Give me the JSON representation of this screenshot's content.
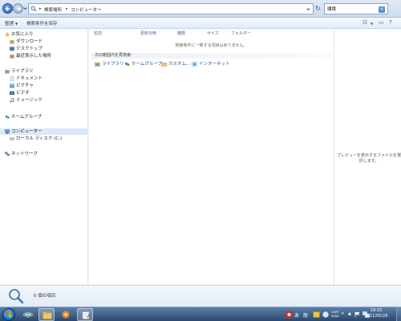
{
  "window": {
    "breadcrumb": [
      "検索場所",
      "コンピューター"
    ],
    "search_value": "環境"
  },
  "toolbar": {
    "organize_label": "整理",
    "save_search_label": "検索条件を保存"
  },
  "nav": {
    "favorites": {
      "label": "お気に入り",
      "items": [
        {
          "label": "ダウンロード",
          "icon": "download-folder-icon"
        },
        {
          "label": "デスクトップ",
          "icon": "desktop-icon"
        },
        {
          "label": "最近表示した場所",
          "icon": "recent-places-icon"
        }
      ]
    },
    "libraries": {
      "label": "ライブラリ",
      "items": [
        {
          "label": "ドキュメント",
          "icon": "documents-icon"
        },
        {
          "label": "ピクチャ",
          "icon": "pictures-icon"
        },
        {
          "label": "ビデオ",
          "icon": "videos-icon"
        },
        {
          "label": "ミュージック",
          "icon": "music-icon"
        }
      ]
    },
    "homegroup": {
      "label": "ホームグループ"
    },
    "computer": {
      "label": "コンピューター",
      "items": [
        {
          "label": "ローカル ディスク (C:)",
          "icon": "local-disk-icon"
        }
      ]
    },
    "network": {
      "label": "ネットワーク"
    }
  },
  "content": {
    "columns": [
      "名前",
      "更新日時",
      "種類",
      "サイズ",
      "フォルダー"
    ],
    "empty_message": "検索条件に一致する項目はありません。",
    "search_again_label": "次の範囲内を再検索:",
    "locations": [
      {
        "label": "ライブラリ",
        "icon": "library-icon"
      },
      {
        "label": "ホームグループ",
        "icon": "homegroup-icon"
      },
      {
        "label": "カスタム...",
        "icon": "custom-folder-icon"
      },
      {
        "label": "インターネット",
        "icon": "internet-icon"
      }
    ]
  },
  "preview": {
    "message": "プレビューを表示するファイルを選択します。"
  },
  "details": {
    "item_count": "0 個の項目"
  },
  "taskbar": {
    "ime_mode": "あ",
    "ime_kana": "般",
    "ime_caps": "CAPS",
    "ime_kana_lock": "KANA",
    "clock_time": "19:15",
    "clock_date": "2011/05/28"
  }
}
